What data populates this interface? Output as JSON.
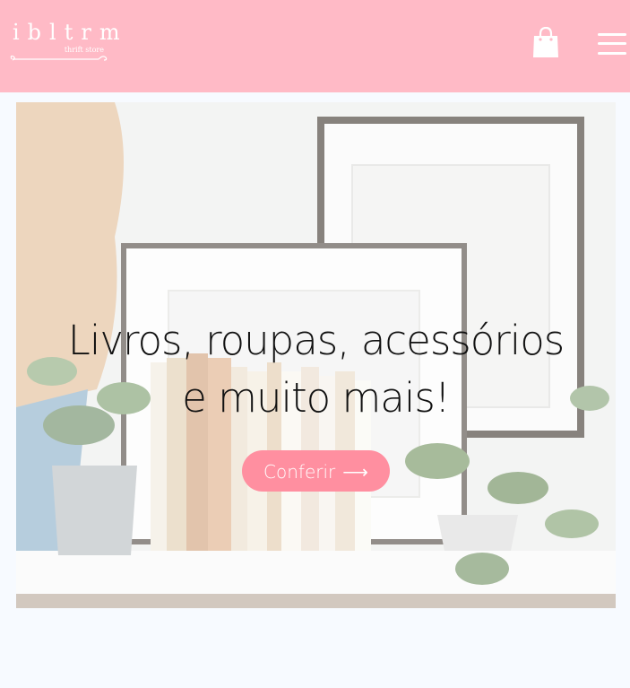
{
  "header": {
    "logo_text": "ibltrm",
    "logo_tagline": "thrift store",
    "cart_icon": "shopping-bag-icon",
    "menu_icon": "hamburger-menu-icon"
  },
  "hero": {
    "title_line1": "Livros, roupas, acessórios",
    "title_line2": "e muito mais!",
    "cta_label": "Conferir",
    "cta_arrow": "⟶"
  },
  "colors": {
    "header_bg": "#ffbac6",
    "cta_bg": "#ff8fa0",
    "page_bg": "#f7faff"
  }
}
